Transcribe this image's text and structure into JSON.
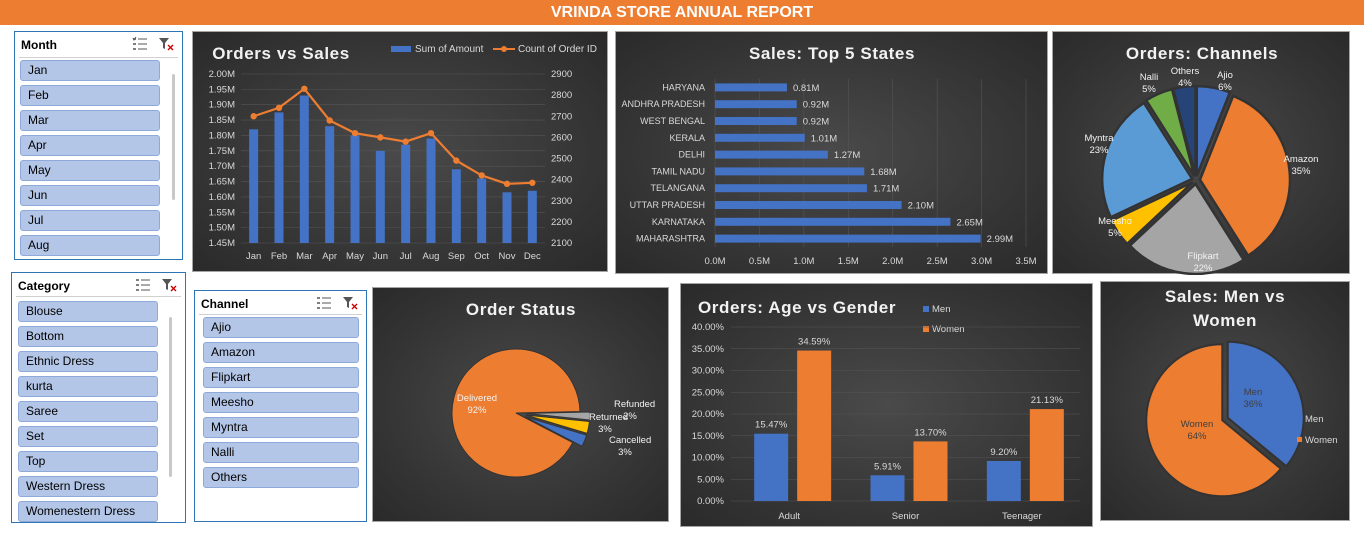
{
  "report": {
    "title": "VRINDA STORE ANNUAL REPORT"
  },
  "slicers": {
    "month": {
      "header": "Month",
      "items": [
        "Jan",
        "Feb",
        "Mar",
        "Apr",
        "May",
        "Jun",
        "Jul",
        "Aug"
      ]
    },
    "category": {
      "header": "Category",
      "items": [
        "Blouse",
        "Bottom",
        "Ethnic Dress",
        "kurta",
        "Saree",
        "Set",
        "Top",
        "Western Dress",
        "Womenestern Dress"
      ]
    },
    "channel": {
      "header": "Channel",
      "items": [
        "Ajio",
        "Amazon",
        "Flipkart",
        "Meesho",
        "Myntra",
        "Nalli",
        "Others"
      ]
    }
  },
  "chart_data": [
    {
      "id": "orders_vs_sales",
      "type": "bar",
      "title": "Orders vs Sales",
      "categories": [
        "Jan",
        "Feb",
        "Mar",
        "Apr",
        "May",
        "Jun",
        "Jul",
        "Aug",
        "Sep",
        "Oct",
        "Nov",
        "Dec"
      ],
      "series": [
        {
          "name": "Sum of Amount",
          "type": "bar",
          "axis": "left",
          "values": [
            1.82,
            1.875,
            1.93,
            1.83,
            1.8,
            1.75,
            1.77,
            1.79,
            1.69,
            1.66,
            1.615,
            1.62
          ]
        },
        {
          "name": "Count of Order ID",
          "type": "line",
          "axis": "right",
          "values": [
            2700,
            2740,
            2830,
            2680,
            2620,
            2600,
            2580,
            2620,
            2490,
            2420,
            2380,
            2385
          ]
        }
      ],
      "y_left": {
        "ylim": [
          1.45,
          2.0
        ],
        "ticks": [
          "1.45M",
          "1.50M",
          "1.55M",
          "1.60M",
          "1.65M",
          "1.70M",
          "1.75M",
          "1.80M",
          "1.85M",
          "1.90M",
          "1.95M",
          "2.00M"
        ]
      },
      "y_right": {
        "ylim": [
          2100,
          2900
        ],
        "ticks": [
          "2100",
          "2200",
          "2300",
          "2400",
          "2500",
          "2600",
          "2700",
          "2800",
          "2900"
        ]
      },
      "legend": "top-right",
      "colors": {
        "bar": "#4472c4",
        "line": "#ed7d31"
      }
    },
    {
      "id": "top_states",
      "type": "bar",
      "orientation": "horizontal",
      "title": "Sales: Top 5 States",
      "categories": [
        "HARYANA",
        "ANDHRA PRADESH",
        "WEST BENGAL",
        "KERALA",
        "DELHI",
        "TAMIL NADU",
        "TELANGANA",
        "UTTAR PRADESH",
        "KARNATAKA",
        "MAHARASHTRA"
      ],
      "values": [
        0.81,
        0.92,
        0.92,
        1.01,
        1.27,
        1.68,
        1.71,
        2.1,
        2.65,
        2.99
      ],
      "data_labels": [
        "0.81M",
        "0.92M",
        "0.92M",
        "1.01M",
        "1.27M",
        "1.68M",
        "1.71M",
        "2.10M",
        "2.65M",
        "2.99M"
      ],
      "xlim": [
        0,
        3.5
      ],
      "x_ticks": [
        "0.0M",
        "0.5M",
        "1.0M",
        "1.5M",
        "2.0M",
        "2.5M",
        "3.0M",
        "3.5M"
      ],
      "colors": {
        "bar": "#4472c4"
      }
    },
    {
      "id": "channels",
      "type": "pie",
      "title": "Orders: Channels",
      "slices": [
        {
          "label": "Ajio",
          "pct": "6%",
          "value": 6,
          "color": "#4472c4"
        },
        {
          "label": "Amazon",
          "pct": "35%",
          "value": 35,
          "color": "#ed7d31"
        },
        {
          "label": "Flipkart",
          "pct": "22%",
          "value": 22,
          "color": "#a5a5a5"
        },
        {
          "label": "Meesho",
          "pct": "5%",
          "value": 5,
          "color": "#ffc000"
        },
        {
          "label": "Myntra",
          "pct": "23%",
          "value": 23,
          "color": "#5b9bd5"
        },
        {
          "label": "Nalli",
          "pct": "5%",
          "value": 5,
          "color": "#70ad47"
        },
        {
          "label": "Others",
          "pct": "4%",
          "value": 4,
          "color": "#264478"
        }
      ]
    },
    {
      "id": "order_status",
      "type": "pie",
      "title": "Order Status",
      "slices": [
        {
          "label": "Delivered",
          "pct": "92%",
          "value": 92,
          "color": "#ed7d31"
        },
        {
          "label": "Refunded",
          "pct": "2%",
          "value": 2,
          "color": "#a5a5a5"
        },
        {
          "label": "Returned",
          "pct": "3%",
          "value": 3,
          "color": "#ffc000"
        },
        {
          "label": "Cancelled",
          "pct": "3%",
          "value": 3,
          "color": "#4472c4"
        }
      ]
    },
    {
      "id": "age_gender",
      "type": "bar",
      "title": "Orders: Age vs Gender",
      "categories": [
        "Adult",
        "Senior",
        "Teenager"
      ],
      "series": [
        {
          "name": "Men",
          "values": [
            15.47,
            5.91,
            9.2
          ],
          "labels": [
            "15.47%",
            "5.91%",
            "9.20%"
          ],
          "color": "#4472c4"
        },
        {
          "name": "Women",
          "values": [
            34.59,
            13.7,
            21.13
          ],
          "labels": [
            "34.59%",
            "13.70%",
            "21.13%"
          ],
          "color": "#ed7d31"
        }
      ],
      "ylim": [
        0,
        40
      ],
      "y_ticks": [
        "0.00%",
        "5.00%",
        "10.00%",
        "15.00%",
        "20.00%",
        "25.00%",
        "30.00%",
        "35.00%",
        "40.00%"
      ],
      "legend": "top"
    },
    {
      "id": "men_women",
      "type": "pie",
      "title": "Sales: Men vs Women",
      "slices": [
        {
          "label": "Men",
          "pct": "36%",
          "value": 36,
          "color": "#4472c4"
        },
        {
          "label": "Women",
          "pct": "64%",
          "value": 64,
          "color": "#ed7d31"
        }
      ],
      "legend": "right"
    }
  ]
}
